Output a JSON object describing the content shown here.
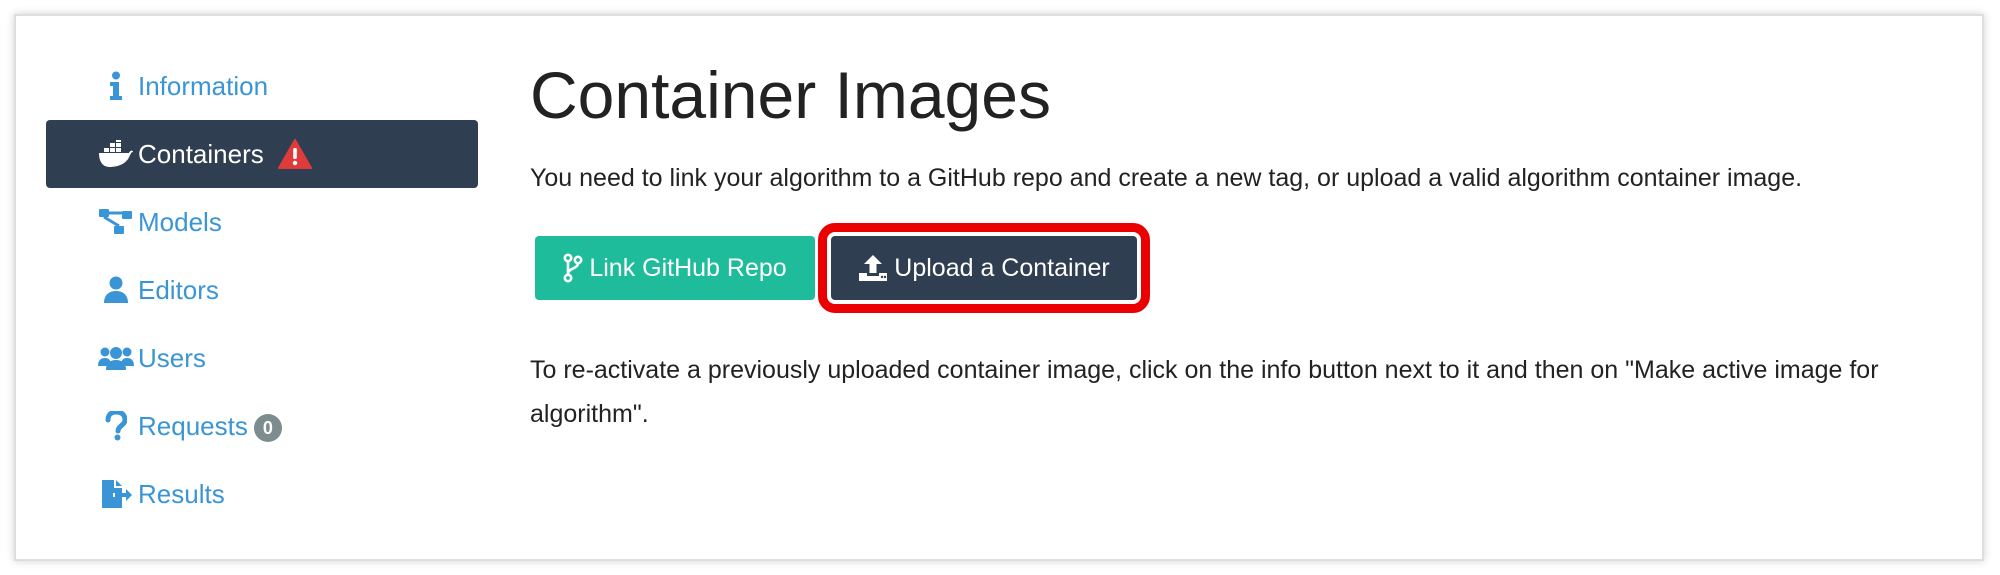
{
  "sidebar": {
    "items": [
      {
        "label": "Information",
        "icon": "info-icon",
        "active": false
      },
      {
        "label": "Containers",
        "icon": "docker-icon",
        "active": true,
        "warning_icon": "warning-icon"
      },
      {
        "label": "Models",
        "icon": "sitemap-icon",
        "active": false
      },
      {
        "label": "Editors",
        "icon": "user-icon",
        "active": false
      },
      {
        "label": "Users",
        "icon": "users-icon",
        "active": false
      },
      {
        "label": "Requests",
        "icon": "question-icon",
        "active": false,
        "badge": "0"
      },
      {
        "label": "Results",
        "icon": "file-export-icon",
        "active": false
      }
    ]
  },
  "main": {
    "title": "Container Images",
    "description": "You need to link your algorithm to a GitHub repo and create a new tag, or upload a valid algorithm container image.",
    "buttons": {
      "link_github": "Link GitHub Repo",
      "upload_container": "Upload a Container"
    },
    "reactivate_note": "To re-activate a previously uploaded container image, click on the info button next to it and then on \"Make active image for algorithm\"."
  },
  "colors": {
    "link": "#3a95d6",
    "active_bg": "#2f3e51",
    "success": "#1fbc9c",
    "danger": "#e03b3b",
    "highlight": "#ea0000",
    "badge": "#7d8c8e"
  }
}
